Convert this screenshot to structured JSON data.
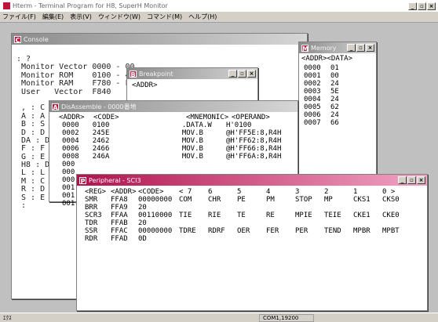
{
  "app": {
    "title": "Hterm - Terminal Program for H8, SuperH Monitor",
    "menu": [
      "ファイル(F)",
      "編集(E)",
      "表示(V)",
      "ウィンドウ(W)",
      "コマンド(M)",
      "ヘルプ(H)"
    ],
    "controls": [
      "_",
      "▫",
      "×"
    ],
    "status_left": "ｴｸｽ",
    "status_port": "COM1,19200"
  },
  "console": {
    "title": "Console",
    "icon": "C",
    "lines": [
      ": ?",
      " Monitor Vector 0000 - 00",
      " Monitor ROM    0100 - 4E",
      " Monitor RAM    F780 - F6",
      " User   Vector  F840",
      "",
      " , : C",
      " A : A",
      " B : S",
      " D : D",
      " DA : D",
      " F : F",
      " G : E",
      " H8 : D",
      " L : L",
      " M : C",
      " R : D",
      " S : E",
      " :"
    ]
  },
  "breakpoint": {
    "title": "Breakpoint",
    "icon": "B",
    "header": "<ADDR>",
    "controls": [
      "_",
      "▫",
      "×"
    ]
  },
  "memory": {
    "title": "Memory",
    "icon": "M",
    "header": "<ADDR><DATA>",
    "controls": [
      "_",
      "▫",
      "×"
    ],
    "rows": [
      [
        "0000",
        "01"
      ],
      [
        "0001",
        "00"
      ],
      [
        "0002",
        "24"
      ],
      [
        "0003",
        "5E"
      ],
      [
        "0004",
        "24"
      ],
      [
        "0005",
        "62"
      ],
      [
        "0006",
        "24"
      ],
      [
        "0007",
        "66"
      ]
    ]
  },
  "disassemble": {
    "title": "DisAssemble - 0000番地",
    "icon": "A",
    "headers": [
      "<ADDR>",
      "<CODE>",
      "<MNEMONIC>",
      "<OPERAND>"
    ],
    "rows": [
      [
        "0000",
        "0100",
        ".DATA.W",
        "H'0100"
      ],
      [
        "0002",
        "245E",
        "MOV.B",
        "@H'FF5E:8,R4H"
      ],
      [
        "0004",
        "2462",
        "MOV.B",
        "@H'FF62:8,R4H"
      ],
      [
        "0006",
        "2466",
        "MOV.B",
        "@H'FF66:8,R4H"
      ],
      [
        "0008",
        "246A",
        "MOV.B",
        "@H'FF6A:8,R4H"
      ],
      [
        "000",
        "",
        "",
        ""
      ],
      [
        "000",
        "",
        "",
        ""
      ],
      [
        "000",
        "",
        "",
        ""
      ],
      [
        "001",
        "",
        "",
        ""
      ],
      [
        "001",
        "",
        "",
        ""
      ],
      [
        "001",
        "",
        "",
        ""
      ]
    ]
  },
  "peripheral": {
    "title": "Peripheral - SCI3",
    "icon": "P",
    "controls": [
      "_",
      "▫",
      "×"
    ],
    "headers": [
      "<REG>",
      "<ADDR>",
      "<CODE>",
      "< 7",
      "6",
      "5",
      "4",
      "3",
      "2",
      "1",
      "0 >"
    ],
    "rows": [
      [
        "SMR",
        "FFA8",
        "00000000",
        "COM",
        "CHR",
        "PE",
        "PM",
        "STOP",
        "MP",
        "CKS1",
        "CKS0"
      ],
      [
        "BRR",
        "FFA9",
        "20",
        "",
        "",
        "",
        "",
        "",
        "",
        "",
        ""
      ],
      [
        "SCR3",
        "FFAA",
        "00110000",
        "TIE",
        "RIE",
        "TE",
        "RE",
        "MPIE",
        "TEIE",
        "CKE1",
        "CKE0"
      ],
      [
        "TDR",
        "FFAB",
        "20",
        "",
        "",
        "",
        "",
        "",
        "",
        "",
        ""
      ],
      [
        "SSR",
        "FFAC",
        "00000000",
        "TDRE",
        "RDRF",
        "OER",
        "FER",
        "PER",
        "TEND",
        "MPBR",
        "MPBT"
      ],
      [
        "RDR",
        "FFAD",
        "0D",
        "",
        "",
        "",
        "",
        "",
        "",
        "",
        ""
      ]
    ]
  },
  "colors": {
    "title_active": "#b0124d",
    "title_inactive": "#8c8c8c",
    "desktop": "#c0c0c0"
  }
}
